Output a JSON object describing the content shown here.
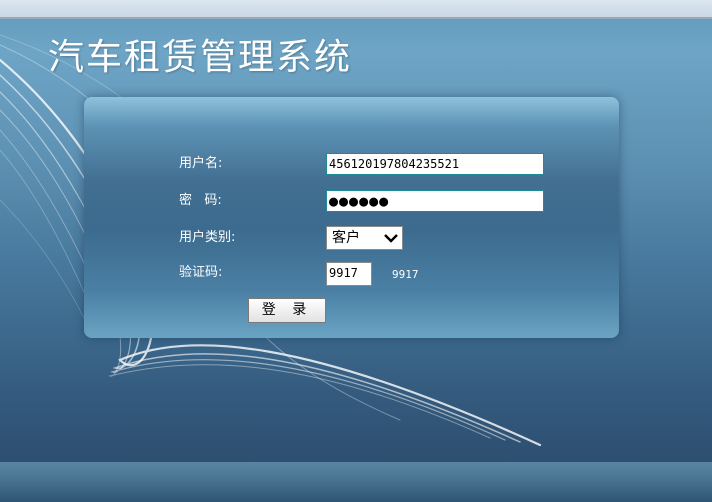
{
  "app": {
    "title": "汽车租赁管理系统"
  },
  "login_form": {
    "username": {
      "label": "用户名:",
      "value": "456120197804235521"
    },
    "password": {
      "label": "密   码:",
      "masked_value": "●●●●●●"
    },
    "user_type": {
      "label": "用户类别:",
      "selected": "客户"
    },
    "captcha": {
      "label": "验证码:",
      "input_value": "9917",
      "display_code": "9917"
    },
    "login_button": "登 录"
  },
  "colors": {
    "background_top": "#6ea5c6",
    "background_bottom": "#2b4a68",
    "panel": "#426f92",
    "input_border": "#1d8a9a",
    "text": "#ffffff"
  }
}
